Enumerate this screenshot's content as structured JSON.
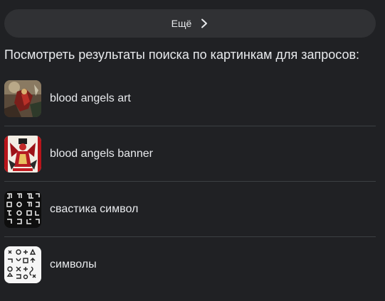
{
  "more_button": {
    "label": "Ещё",
    "icon": "chevron-right-icon"
  },
  "heading": "Посмотреть результаты поиска по картинкам для запросов:",
  "related_searches": [
    {
      "label": "blood angels art",
      "thumbnail": "blood-angels-art-thumbnail"
    },
    {
      "label": "blood angels banner",
      "thumbnail": "blood-angels-banner-thumbnail"
    },
    {
      "label": "свастика символ",
      "thumbnail": "swastika-symbols-thumbnail"
    },
    {
      "label": "символы",
      "thumbnail": "symbols-thumbnail"
    }
  ],
  "colors": {
    "background": "#202124",
    "pill": "#303134",
    "text": "#e8eaed",
    "divider": "#3c4043"
  }
}
